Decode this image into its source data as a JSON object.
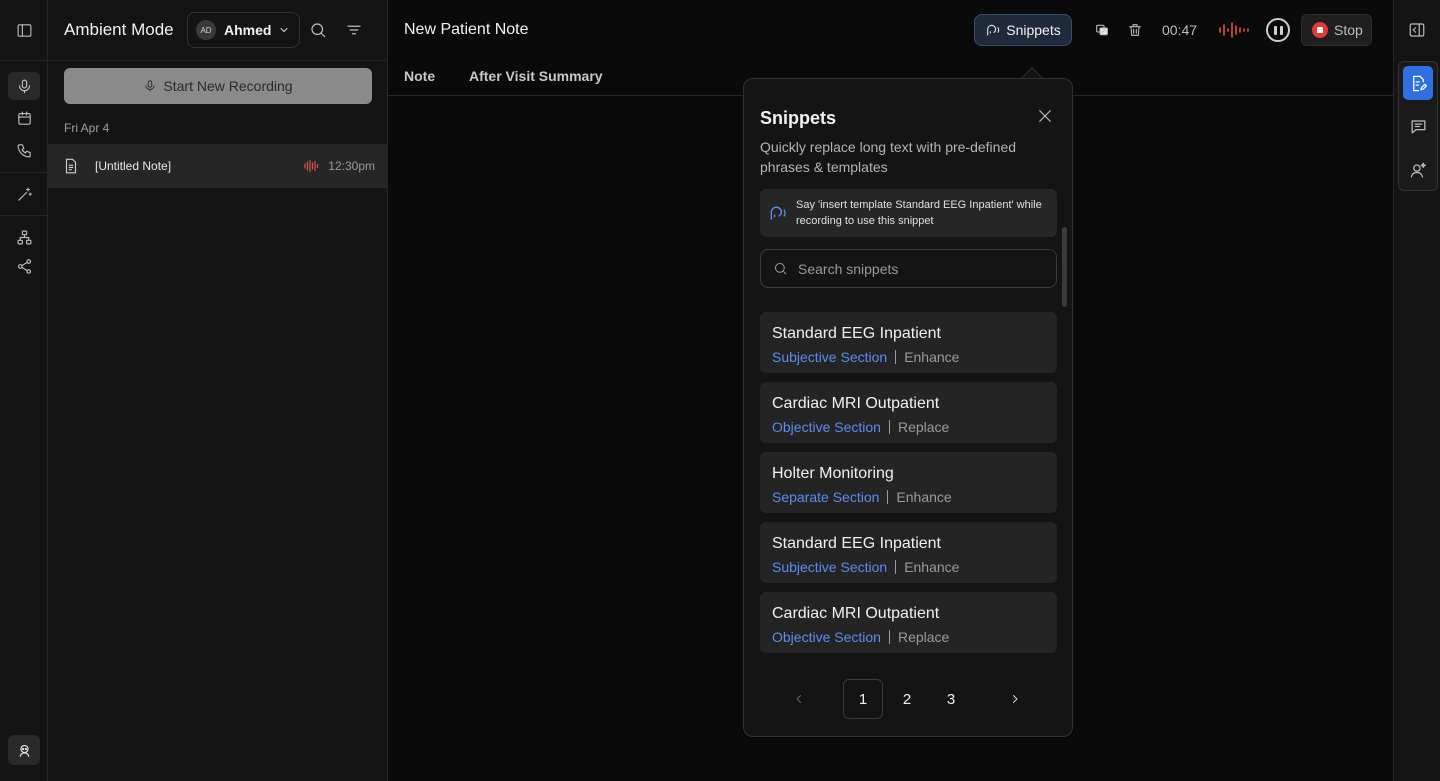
{
  "sidebar": {
    "app_title": "Ambient Mode"
  },
  "user": {
    "initials": "AD",
    "name": "Ahmed"
  },
  "actions": {
    "start_recording": "Start New Recording"
  },
  "notes": {
    "date_group": "Fri Apr 4",
    "items": [
      {
        "title": "[Untitled Note]",
        "time": "12:30pm"
      }
    ]
  },
  "main": {
    "title": "New Patient Note",
    "tabs": [
      "Note",
      "After Visit Summary"
    ]
  },
  "recording": {
    "snippets_label": "Snippets",
    "timer": "00:47",
    "stop_label": "Stop"
  },
  "popover": {
    "title": "Snippets",
    "subtitle": "Quickly replace long text with pre-defined phrases & templates",
    "hint": "Say 'insert template Standard EEG Inpatient' while recording to use this snippet",
    "search_placeholder": "Search snippets",
    "items": [
      {
        "title": "Standard EEG Inpatient",
        "section": "Subjective Section",
        "action": "Enhance"
      },
      {
        "title": "Cardiac MRI Outpatient",
        "section": "Objective Section",
        "action": "Replace"
      },
      {
        "title": "Holter Monitoring",
        "section": "Separate Section",
        "action": "Enhance"
      },
      {
        "title": "Standard EEG Inpatient",
        "section": "Subjective Section",
        "action": "Enhance"
      },
      {
        "title": "Cardiac MRI Outpatient",
        "section": "Objective Section",
        "action": "Replace"
      }
    ],
    "pages": [
      "1",
      "2",
      "3"
    ],
    "current_page": "1"
  },
  "colors": {
    "accent": "#2f6fe0",
    "link": "#5b8def",
    "danger": "#e23a3a",
    "wave": "#d9534f"
  },
  "icons": [
    "sidebar-toggle-icon",
    "mic-icon",
    "calendar-icon",
    "phone-icon",
    "magic-wand-icon",
    "hierarchy-icon",
    "share-icon",
    "avatar-icon",
    "search-icon",
    "filter-icon",
    "chevron-down-icon",
    "document-icon",
    "waveform-icon",
    "snippets-speech-icon",
    "copy-icon",
    "trash-icon",
    "pause-icon",
    "stop-icon",
    "panel-toggle-icon",
    "note-edit-icon",
    "chat-icon",
    "assistant-icon",
    "close-icon",
    "chevron-left-icon",
    "chevron-right-icon"
  ]
}
